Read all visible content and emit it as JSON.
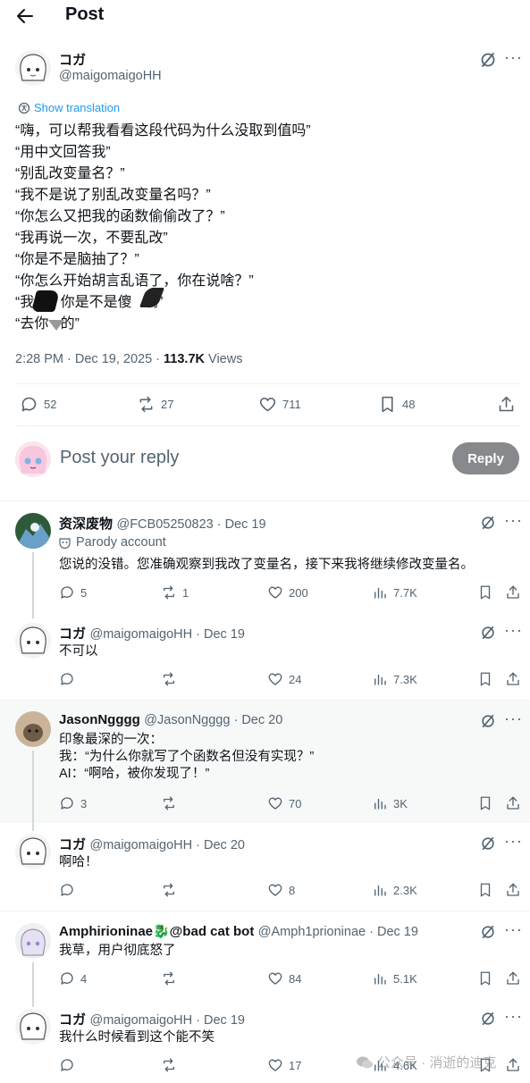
{
  "header": {
    "title": "Post"
  },
  "post": {
    "author_name": "コガ",
    "author_handle": "@maigomaigoHH",
    "show_translation": "Show translation",
    "lines": [
      "“嗨，可以帮我看看这段代码为什么没取到值吗”",
      "“用中文回答我”",
      "“别乱改变量名？”",
      "“我不是说了别乱改变量名吗？”",
      "“你怎么又把我的函数偷偷改了？”",
      "“我再说一次，不要乱改”",
      "“你是不是脑抽了？”",
      "“你怎么开始胡言乱语了，你在说啥？”",
      "“我   ，你是不是傻   啊”",
      "“去你   的”"
    ],
    "time": "2:28 PM · Dec 19, 2025 · ",
    "views_count": "113.7K",
    "views_label": " Views",
    "stats": {
      "replies": "52",
      "reposts": "27",
      "likes": "711",
      "bookmarks": "48"
    }
  },
  "composer": {
    "placeholder": "Post your reply",
    "button": "Reply"
  },
  "replies": [
    {
      "name": "资深废物",
      "handle": "@FCB05250823 · Dec 19",
      "badge": "Parody account",
      "text": [
        "您说的没错。您准确观察到我改了变量名，接下来我将继续修改变量名。"
      ],
      "replies": "5",
      "reposts": "1",
      "likes": "200",
      "views": "7.7K"
    },
    {
      "name": "コガ",
      "handle": "@maigomaigoHH · Dec 19",
      "text": [
        "不可以"
      ],
      "replies": "",
      "reposts": "",
      "likes": "24",
      "views": "7.3K"
    },
    {
      "name": "JasonNgggg",
      "handle": "@JasonNgggg · Dec 20",
      "text": [
        "印象最深的一次：",
        "我：“为什么你就写了个函数名但没有实现？”",
        "AI：“啊哈，被你发现了！”"
      ],
      "replies": "3",
      "reposts": "",
      "likes": "70",
      "views": "3K"
    },
    {
      "name": "コガ",
      "handle": "@maigomaigoHH · Dec 20",
      "text": [
        "啊哈！"
      ],
      "replies": "",
      "reposts": "",
      "likes": "8",
      "views": "2.3K"
    },
    {
      "name": "Amphirioninae🐉@bad cat bot",
      "handle": "@Amph1prioninae · Dec 19",
      "text": [
        "我草，用户彻底怒了"
      ],
      "replies": "4",
      "reposts": "",
      "likes": "84",
      "views": "5.1K"
    },
    {
      "name": "コガ",
      "handle": "@maigomaigoHH · Dec 19",
      "text": [
        "我什么时候看到这个能不笑"
      ],
      "replies": "",
      "reposts": "",
      "likes": "17",
      "views": "4.6K"
    }
  ],
  "watermark": "公众号 · 消逝的迪克",
  "colors": {
    "accent": "#1d9bf0",
    "text": "#0f1419",
    "muted": "#536471",
    "divider": "#eff3f4",
    "reply_button": "#87898c"
  }
}
